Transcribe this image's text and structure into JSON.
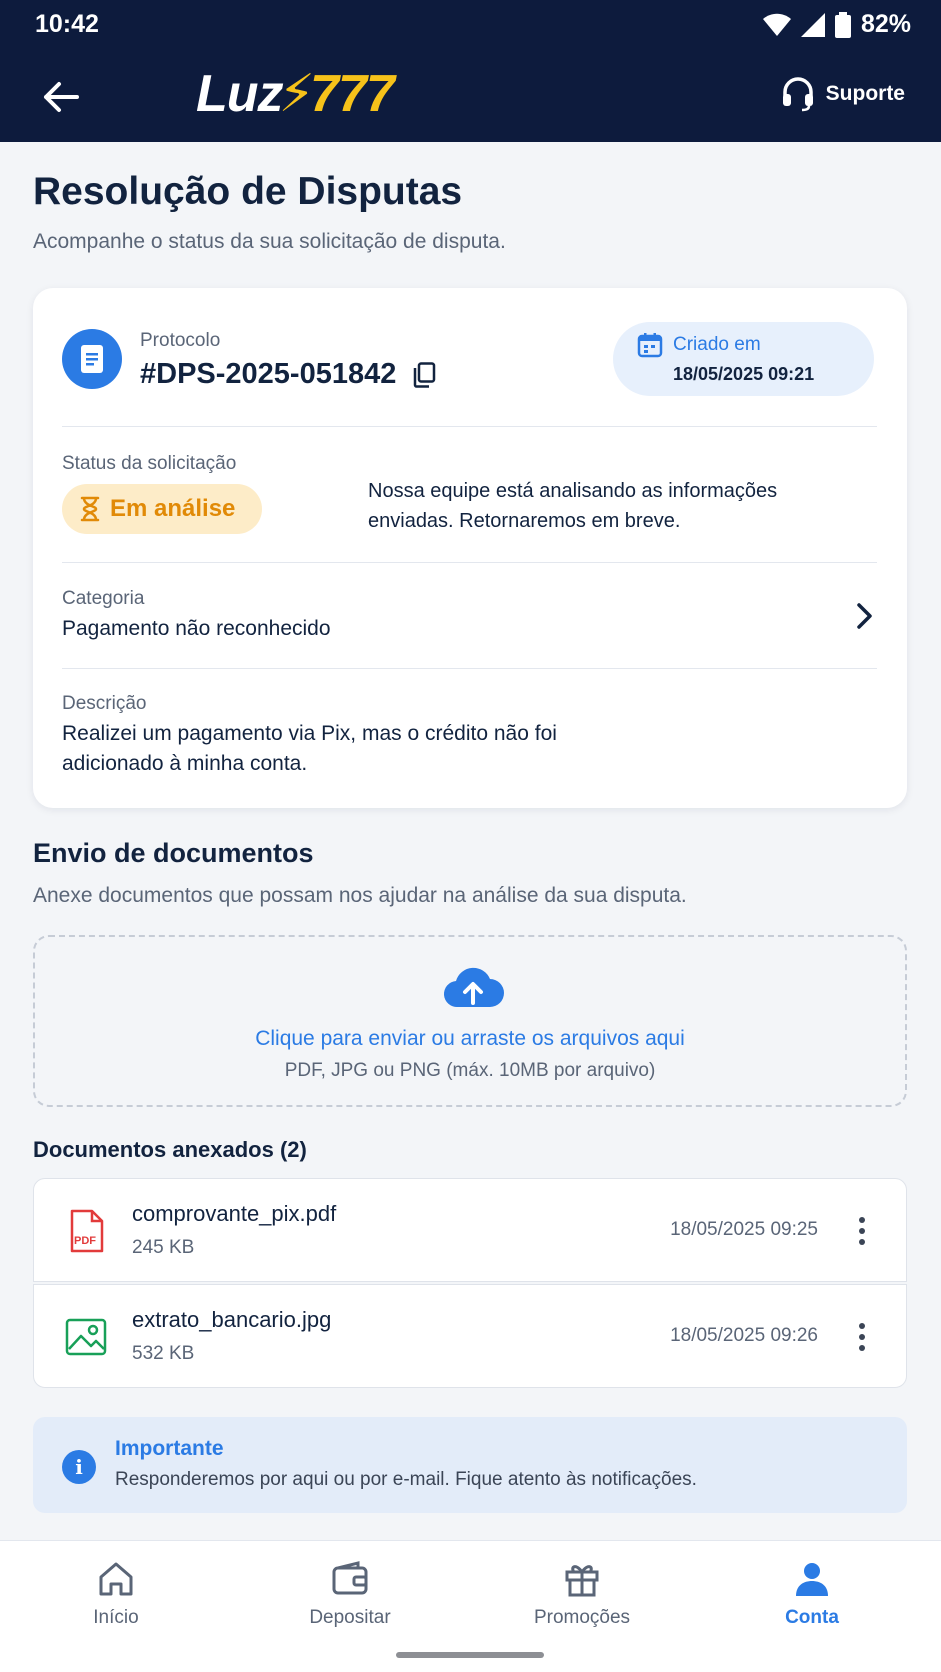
{
  "status_bar": {
    "time": "10:42",
    "battery": "82%"
  },
  "header": {
    "logo_luz": "Luz",
    "logo_bolt": "⚡",
    "logo_num": "777",
    "support_label": "Suporte"
  },
  "page": {
    "title": "Resolução de Disputas",
    "subtitle": "Acompanhe o status da sua solicitação de disputa."
  },
  "dispute": {
    "protocol_label": "Protocolo",
    "protocol_number": "#DPS-2025-051842",
    "created_label": "Criado em",
    "created_date": "18/05/2025 09:21",
    "status_label": "Status da solicitação",
    "status_value": "Em análise",
    "status_description": "Nossa equipe está analisando as informações enviadas. Retornaremos em breve.",
    "category_label": "Categoria",
    "category_value": "Pagamento não reconhecido",
    "description_label": "Descrição",
    "description_value": "Realizei um pagamento via Pix, mas o crédito não foi adicionado à minha conta."
  },
  "documents": {
    "section_title": "Envio de documentos",
    "section_subtitle": "Anexe documentos que possam nos ajudar na análise da sua disputa.",
    "upload_cta": "Clique para enviar ou arraste os arquivos aqui",
    "upload_hint": "PDF, JPG ou PNG (máx. 10MB por arquivo)",
    "attached_title": "Documentos anexados (2)",
    "files": [
      {
        "name": "comprovante_pix.pdf",
        "size": "245 KB",
        "date": "18/05/2025 09:25",
        "icon": "pdf-file-icon"
      },
      {
        "name": "extrato_bancario.jpg",
        "size": "532 KB",
        "date": "18/05/2025 09:26",
        "icon": "image-file-icon"
      }
    ]
  },
  "notice": {
    "title": "Importante",
    "text": "Responderemos por aqui ou por e-mail. Fique atento às notificações."
  },
  "bottom_nav": {
    "items": [
      {
        "label": "Início",
        "icon": "home-icon",
        "active": false
      },
      {
        "label": "Depositar",
        "icon": "wallet-icon",
        "active": false
      },
      {
        "label": "Promoções",
        "icon": "gift-icon",
        "active": false
      },
      {
        "label": "Conta",
        "icon": "user-icon",
        "active": true
      }
    ]
  },
  "colors": {
    "header_bg": "#0d1b3d",
    "accent": "#2b7be4",
    "brand_yellow": "#f6c21a",
    "status_orange": "#e18a07"
  }
}
